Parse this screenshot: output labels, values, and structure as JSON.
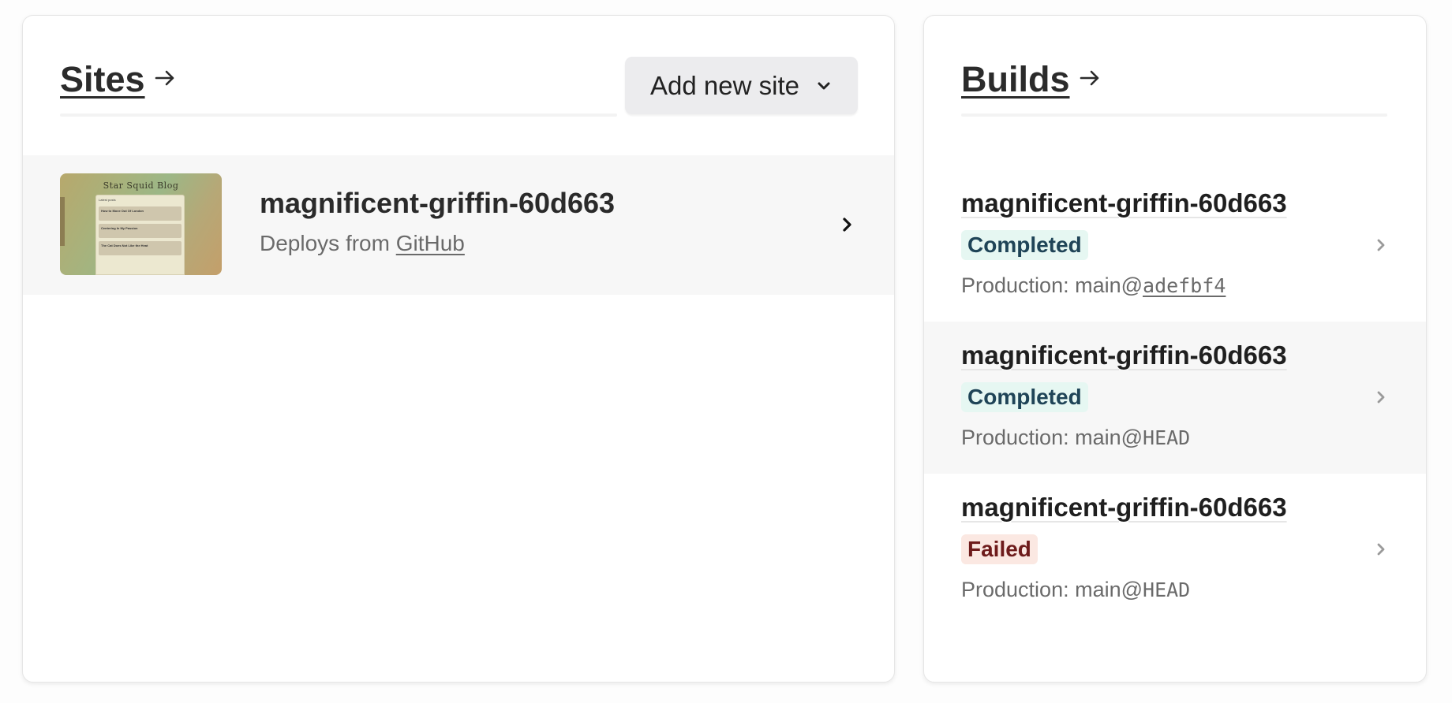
{
  "sites": {
    "title": "Sites",
    "add_button_label": "Add new site",
    "items": [
      {
        "name": "magnificent-griffin-60d663",
        "deploy_prefix": "Deploys from ",
        "deploy_source": "GitHub",
        "thumbnail": {
          "title": "Star Squid Blog",
          "latest_label": "Latest posts",
          "posts": [
            "How to Move Out Of London",
            "Centering In My Passion",
            "The Cat Does Not Like the Heat"
          ]
        }
      }
    ]
  },
  "builds": {
    "title": "Builds",
    "items": [
      {
        "name": "magnificent-griffin-60d663",
        "status": "Completed",
        "meta_prefix": "Production: main@",
        "ref": "adefbf4"
      },
      {
        "name": "magnificent-griffin-60d663",
        "status": "Completed",
        "meta_prefix": "Production: main@",
        "ref": "HEAD"
      },
      {
        "name": "magnificent-griffin-60d663",
        "status": "Failed",
        "meta_prefix": "Production: main@",
        "ref": "HEAD"
      }
    ]
  },
  "colors": {
    "completed_bg": "#e6f7f2",
    "completed_text": "#1f4457",
    "failed_bg": "#fbe8e2",
    "failed_text": "#6e1b1b"
  }
}
